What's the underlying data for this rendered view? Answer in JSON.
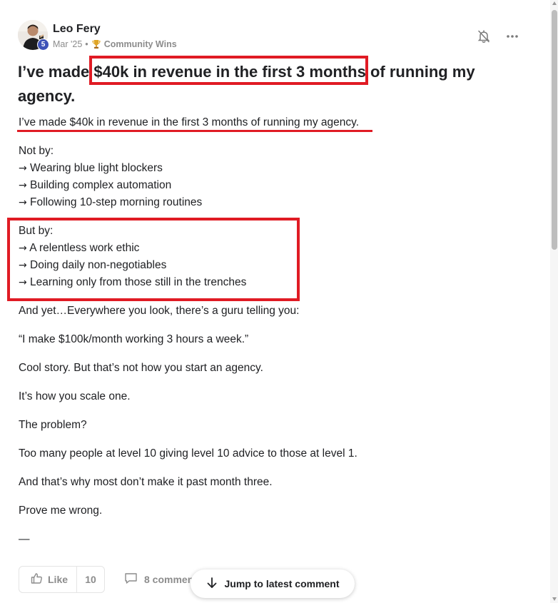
{
  "post": {
    "author": {
      "name": "Leo Fery",
      "level": "5"
    },
    "date": "Mar '25",
    "separator": "•",
    "category": "Community Wins",
    "title_before": "I’ve made ",
    "title_highlight": "$40k in revenue in the first 3 months",
    "title_after": " of running my",
    "title_line2": "agency.",
    "body": {
      "lead": "I’ve made $40k in revenue in the first 3 months of running my agency.",
      "not_by": {
        "heading": "Not by:",
        "items": [
          "Wearing blue light blockers",
          "Building complex automation",
          "Following 10-step morning routines"
        ]
      },
      "but_by": {
        "heading": "But by:",
        "items": [
          "A relentless work ethic",
          "Doing daily non-negotiables",
          "Learning only from those still in the trenches"
        ]
      },
      "arrow": "→",
      "paragraphs": [
        "And yet…Everywhere you look, there’s a guru telling you:",
        "“I make $100k/month working 3 hours a week.”",
        "Cool story. But that’s not how you start an agency.",
        "It’s how you scale one.",
        "The problem?",
        "Too many people at level 10 giving level 10 advice to those at level 1.",
        "And that’s why most don’t make it past month three.",
        "Prove me wrong."
      ],
      "trailing": "—"
    }
  },
  "actions": {
    "like_label": "Like",
    "like_count": "10",
    "comments_label": "8 commen",
    "jump_label": "Jump to latest comment"
  },
  "icons": {
    "notification": "bell-off-icon",
    "more": "more-horizontal-icon",
    "like": "thumbs-up-icon",
    "comment": "comment-icon",
    "jump": "arrow-down-icon",
    "category": "trophy-icon"
  },
  "colors": {
    "annotation": "#e01b24",
    "level_badge": "#3f53b8",
    "muted_text": "#8c8c8c",
    "text": "#202124"
  }
}
